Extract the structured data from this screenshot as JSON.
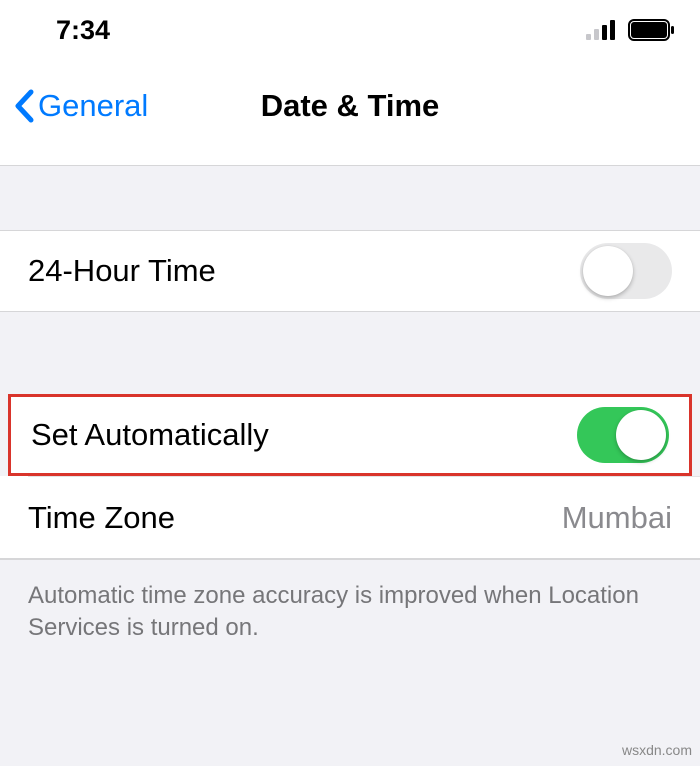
{
  "status": {
    "time": "7:34"
  },
  "nav": {
    "back_label": "General",
    "title": "Date & Time"
  },
  "rows": {
    "twenty_four_hour": {
      "label": "24-Hour Time",
      "on": false
    },
    "set_automatically": {
      "label": "Set Automatically",
      "on": true
    },
    "time_zone": {
      "label": "Time Zone",
      "value": "Mumbai"
    }
  },
  "footer": "Automatic time zone accuracy is improved when Location Services is turned on.",
  "watermark": "wsxdn.com"
}
